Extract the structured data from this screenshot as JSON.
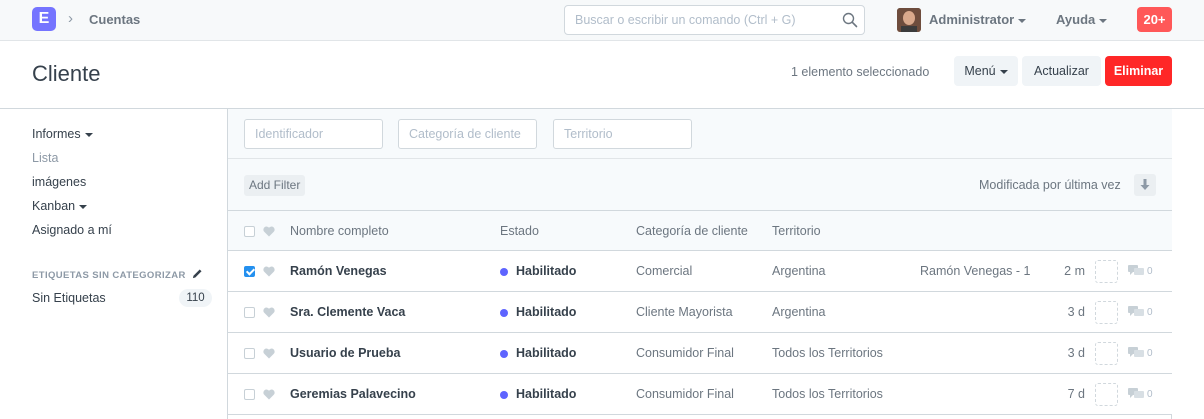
{
  "navbar": {
    "logo_letter": "E",
    "breadcrumb": "Cuentas",
    "search_placeholder": "Buscar o escribir un comando (Ctrl + G)",
    "user_name": "Administrator",
    "help_label": "Ayuda",
    "notifications": "20+"
  },
  "page": {
    "title": "Cliente",
    "selection_text": "1 elemento seleccionado",
    "menu_label": "Menú",
    "refresh_label": "Actualizar",
    "delete_label": "Eliminar"
  },
  "sidebar": {
    "items": [
      {
        "label": "Informes",
        "dropdown": true
      },
      {
        "label": "Lista",
        "dropdown": false
      },
      {
        "label": "imágenes",
        "dropdown": false
      },
      {
        "label": "Kanban",
        "dropdown": true
      },
      {
        "label": "Asignado a mí",
        "dropdown": false
      }
    ],
    "tags_heading": "ETIQUETAS SIN CATEGORIZAR",
    "untagged_label": "Sin Etiquetas",
    "untagged_count": "110"
  },
  "filters": {
    "identifier_placeholder": "Identificador",
    "category_placeholder": "Categoría de cliente",
    "territory_placeholder": "Territorio",
    "add_filter": "Add Filter",
    "sort_label": "Modificada por última vez"
  },
  "table": {
    "columns": [
      "Nombre completo",
      "Estado",
      "Categoría de cliente",
      "Territorio"
    ],
    "rows": [
      {
        "checked": true,
        "name": "Ramón Venegas",
        "status": "Habilitado",
        "category": "Comercial",
        "territory": "Argentina",
        "extra": "Ramón Venegas - 1",
        "time": "2 m",
        "comments": "0"
      },
      {
        "checked": false,
        "name": "Sra. Clemente Vaca",
        "status": "Habilitado",
        "category": "Cliente Mayorista",
        "territory": "Argentina",
        "extra": "",
        "time": "3 d",
        "comments": "0"
      },
      {
        "checked": false,
        "name": "Usuario de Prueba",
        "status": "Habilitado",
        "category": "Consumidor Final",
        "territory": "Todos los Territorios",
        "extra": "",
        "time": "3 d",
        "comments": "0"
      },
      {
        "checked": false,
        "name": "Geremias Palavecino",
        "status": "Habilitado",
        "category": "Consumidor Final",
        "territory": "Todos los Territorios",
        "extra": "",
        "time": "7 d",
        "comments": "0"
      }
    ]
  },
  "colors": {
    "accent": "#7574ff",
    "danger": "#ff2727",
    "status_enabled": "#5e64ff"
  }
}
